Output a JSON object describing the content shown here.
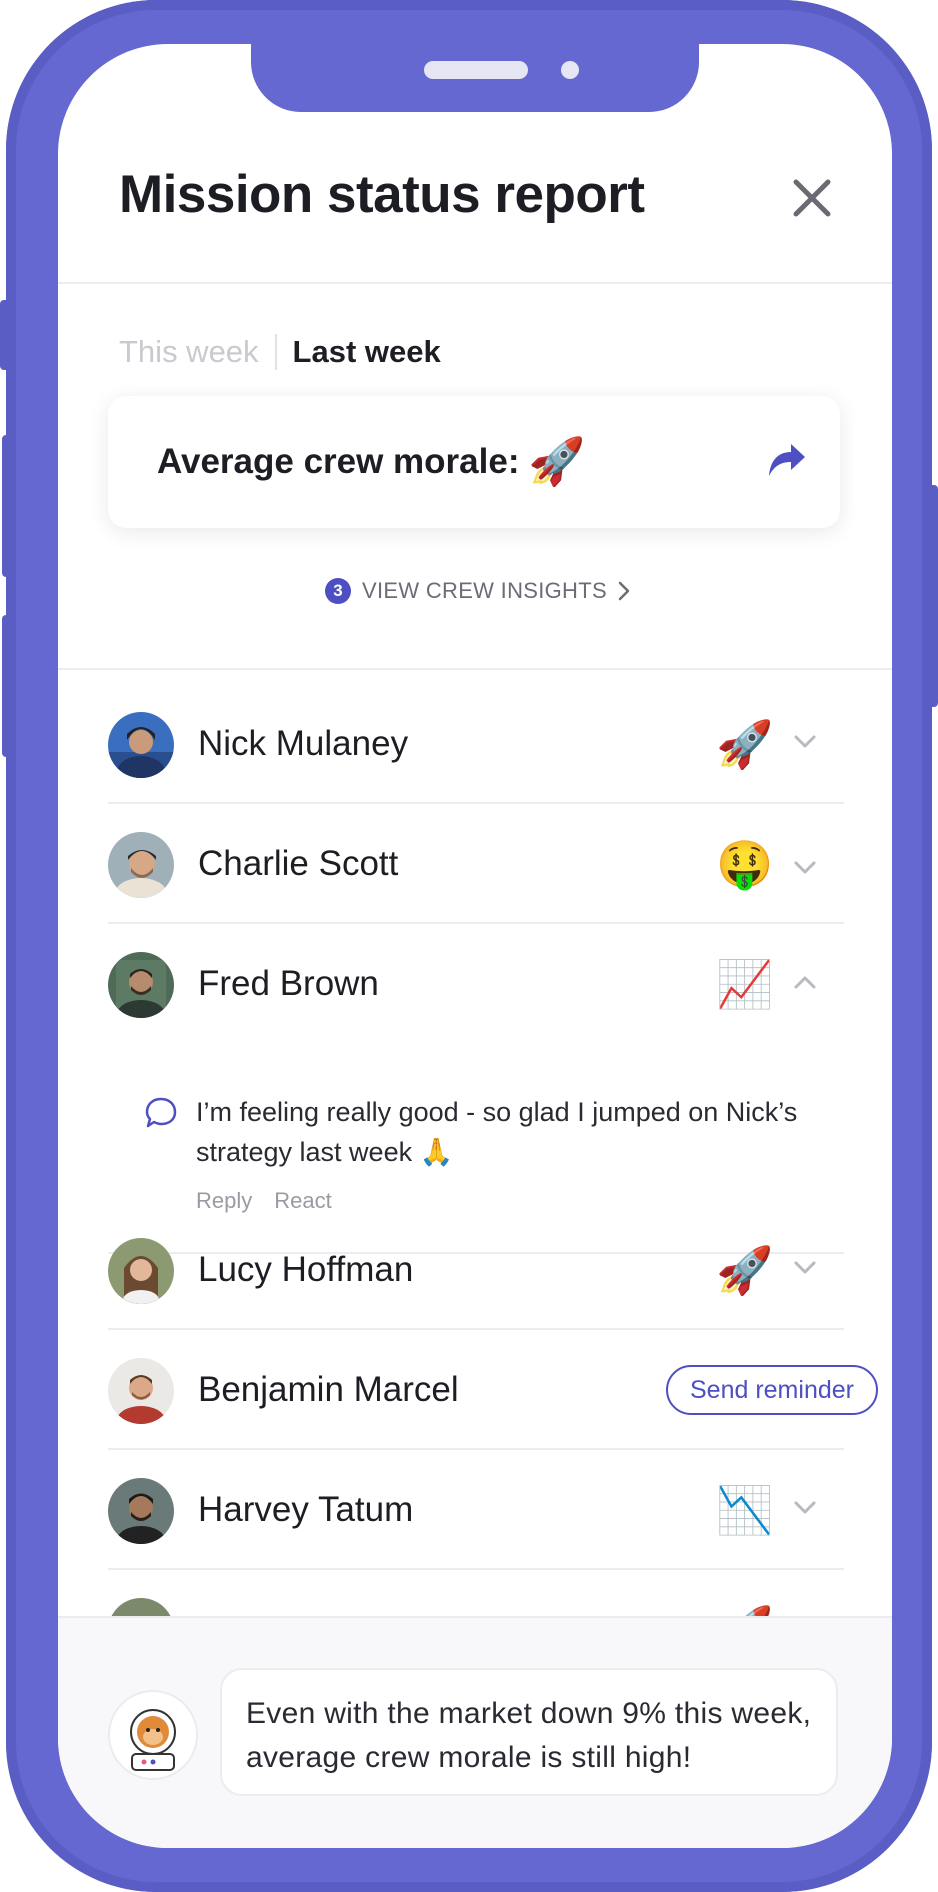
{
  "header": {
    "title": "Mission status report"
  },
  "tabs": [
    {
      "label": "This week",
      "active": false
    },
    {
      "label": "Last week",
      "active": true
    }
  ],
  "morale": {
    "label": "Average crew morale:",
    "emoji": "🚀"
  },
  "insights": {
    "count": "3",
    "label": "VIEW CREW INSIGHTS"
  },
  "crew": [
    {
      "name": "Nick Mulaney",
      "emoji": "🚀",
      "expanded": false
    },
    {
      "name": "Charlie Scott",
      "emoji": "🤑",
      "expanded": false
    },
    {
      "name": "Fred Brown",
      "emoji": "📈",
      "expanded": true
    },
    {
      "name": "Lucy Hoffman",
      "emoji": "🚀",
      "expanded": false
    },
    {
      "name": "Benjamin Marcel",
      "action": "Send reminder"
    },
    {
      "name": "Harvey Tatum",
      "emoji": "📉",
      "expanded": false
    },
    {
      "name": "",
      "emoji": "🚀",
      "expanded": false
    }
  ],
  "comment": {
    "text": "I’m feeling really good - so glad I jumped on Nick’s strategy last week 🙏",
    "reply": "Reply",
    "react": "React"
  },
  "assistant": {
    "message": "Even with the market down 9% this week, average crew morale is still high!"
  },
  "colors": {
    "frame": "#6468d0",
    "accent": "#4d4fc2",
    "text": "#1d1d24",
    "muted": "#c9c9cf"
  }
}
